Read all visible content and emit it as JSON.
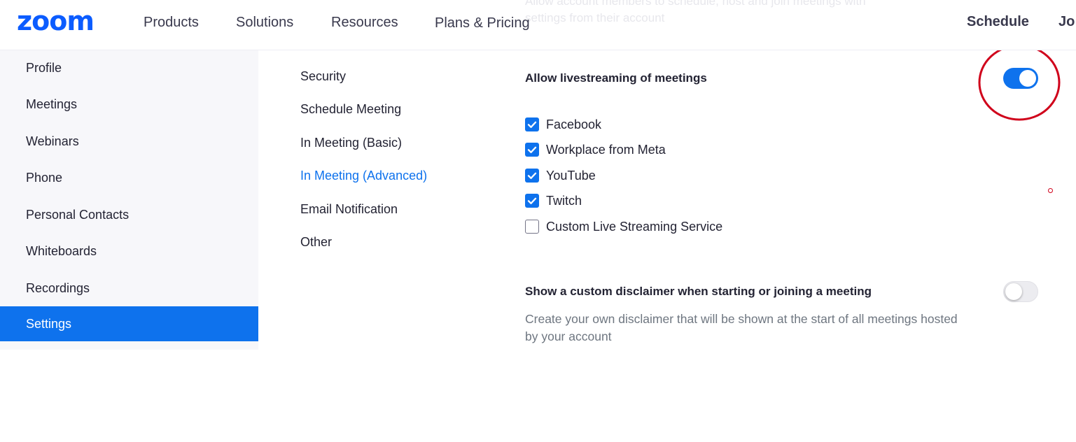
{
  "header": {
    "logo": "zoom",
    "nav_items": [
      "Products",
      "Solutions",
      "Resources",
      "Plans & Pricing"
    ],
    "schedule_label": "Schedule",
    "join_label": "Jo",
    "ghost_lines": [
      "Allow account members to schedule, host and join meetings with",
      "settings from their account"
    ]
  },
  "sidebar": {
    "items": [
      {
        "label": "Profile"
      },
      {
        "label": "Meetings"
      },
      {
        "label": "Webinars"
      },
      {
        "label": "Phone"
      },
      {
        "label": "Personal Contacts"
      },
      {
        "label": "Whiteboards"
      },
      {
        "label": "Recordings"
      },
      {
        "label": "Settings",
        "active": true
      }
    ]
  },
  "subnav": {
    "items": [
      {
        "label": "Security"
      },
      {
        "label": "Schedule Meeting"
      },
      {
        "label": "In Meeting (Basic)"
      },
      {
        "label": "In Meeting (Advanced)",
        "active": true
      },
      {
        "label": "Email Notification"
      },
      {
        "label": "Other"
      }
    ]
  },
  "settings": {
    "livestream": {
      "title": "Allow livestreaming of meetings",
      "enabled": true,
      "options": [
        {
          "label": "Facebook",
          "checked": true
        },
        {
          "label": "Workplace from Meta",
          "checked": true
        },
        {
          "label": "YouTube",
          "checked": true
        },
        {
          "label": "Twitch",
          "checked": true
        },
        {
          "label": "Custom Live Streaming Service",
          "checked": false
        }
      ]
    },
    "disclaimer": {
      "title": "Show a custom disclaimer when starting or joining a meeting",
      "enabled": false,
      "description": "Create your own disclaimer that will be shown at the start of all meetings hosted by your account"
    }
  },
  "colors": {
    "brand": "#0b5cff",
    "accent": "#0e72ed",
    "annotation": "#d0021b"
  },
  "icons": {
    "check": "check-icon"
  }
}
